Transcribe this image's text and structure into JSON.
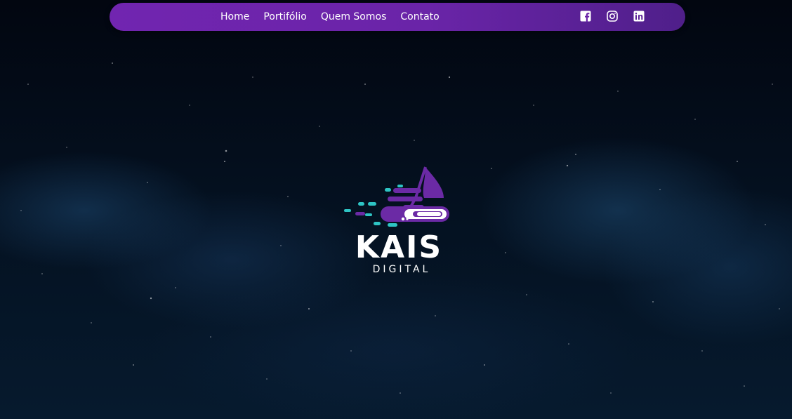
{
  "nav": {
    "links": [
      {
        "label": "Home"
      },
      {
        "label": "Portifólio"
      },
      {
        "label": "Quem Somos"
      },
      {
        "label": "Contato"
      }
    ],
    "social": [
      {
        "icon": "facebook-icon"
      },
      {
        "icon": "instagram-icon"
      },
      {
        "icon": "linkedin-icon"
      }
    ],
    "background_color": "#6a24a8"
  },
  "logo": {
    "word": "KAIS",
    "subtitle": "DIGITAL",
    "colors": {
      "purple": "#6b2aa5",
      "teal": "#2ec4c4",
      "white": "#ffffff"
    }
  }
}
